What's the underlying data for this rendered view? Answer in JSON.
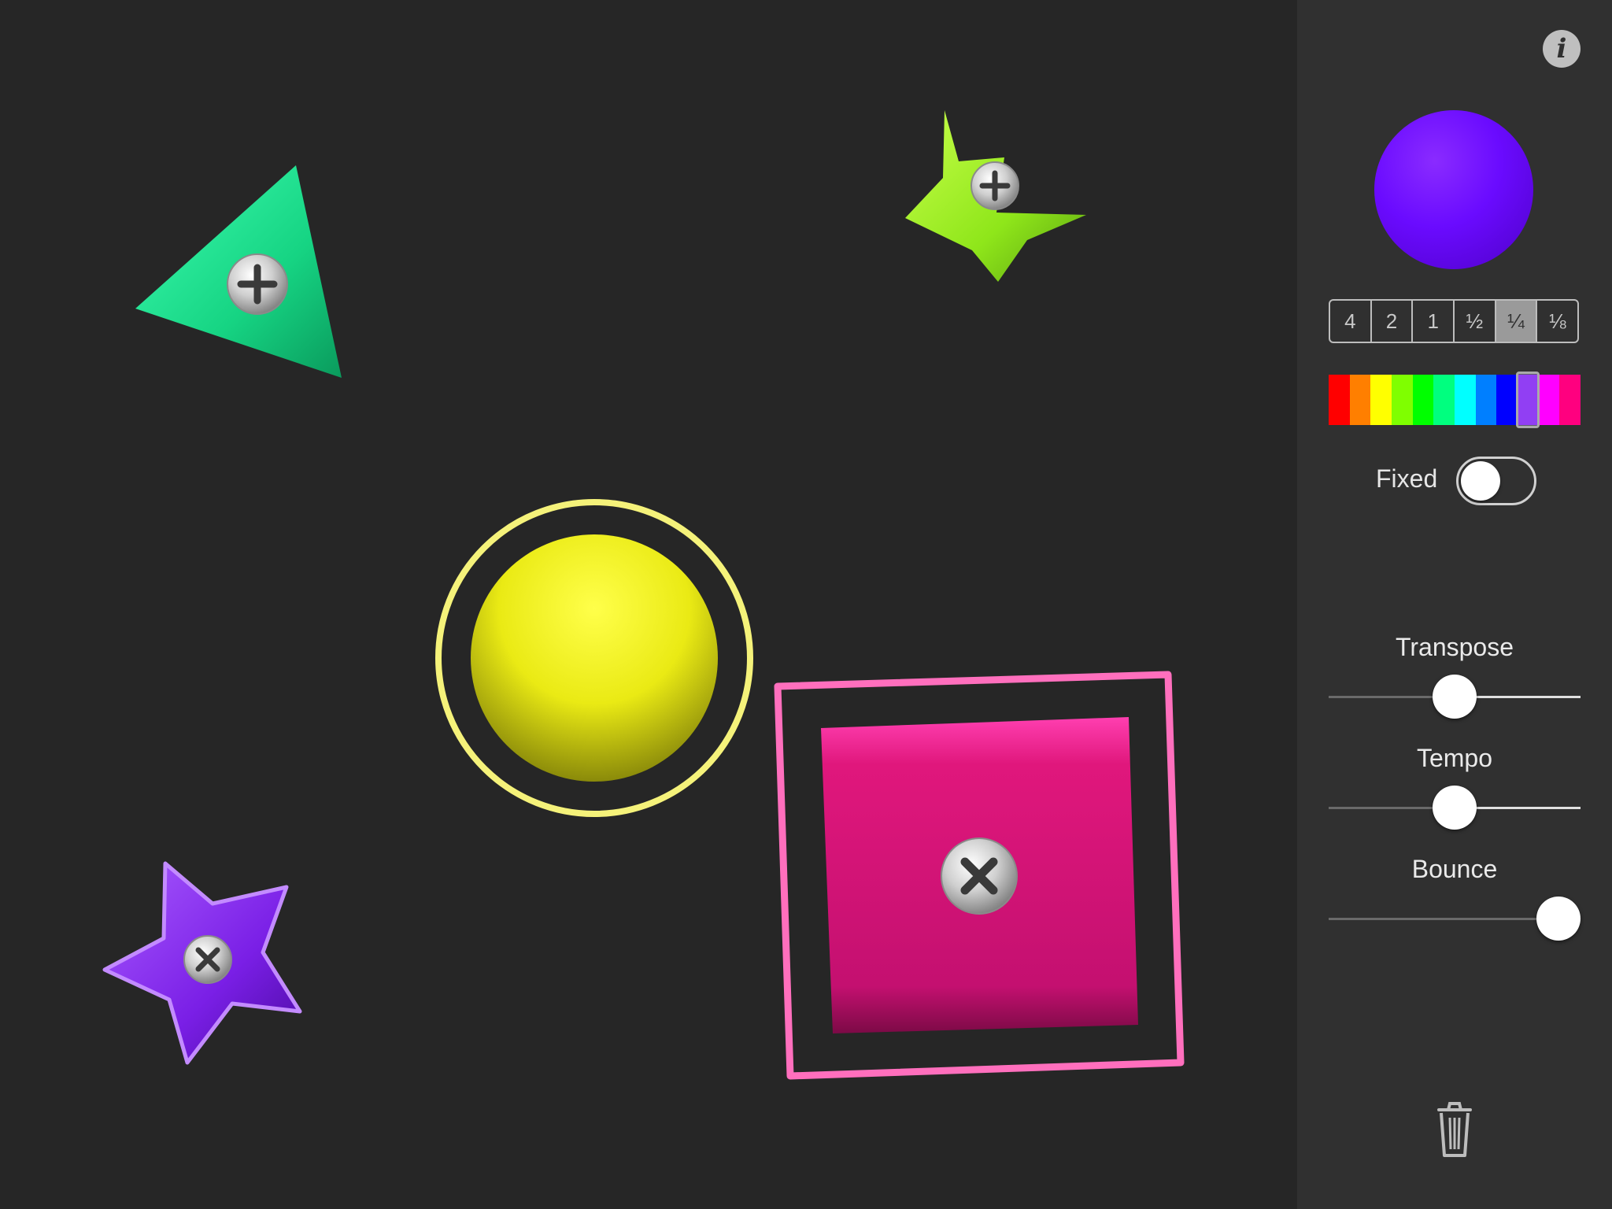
{
  "app": {
    "info_button": "i"
  },
  "toolbar": {
    "duration_options": [
      "4",
      "2",
      "1",
      "½",
      "¼",
      "⅛"
    ],
    "selected_duration": "¼",
    "palette": [
      "#ff0000",
      "#ff7f00",
      "#ffff00",
      "#7fff00",
      "#00ff00",
      "#00ff7f",
      "#00ffff",
      "#007fff",
      "#0000ff",
      "#7f00ff",
      "#ff00ff",
      "#ff007f"
    ],
    "selected_color": "#6a0bff",
    "fixed_label": "Fixed",
    "fixed_on": false
  },
  "sliders": [
    {
      "label": "Transpose",
      "value": 0.5
    },
    {
      "label": "Tempo",
      "value": 0.5
    },
    {
      "label": "Bounce",
      "value": 1.0
    }
  ],
  "shapes": [
    {
      "type": "triangle",
      "color": "#1fe08a",
      "screw": "plus"
    },
    {
      "type": "star",
      "color": "#8fe61a",
      "screw": "plus"
    },
    {
      "type": "circle",
      "color": "#f2f21a",
      "selected": true
    },
    {
      "type": "square",
      "color": "#e0177c",
      "screw": "cross",
      "selected": true
    },
    {
      "type": "star",
      "color": "#7a1fe6",
      "screw": "cross",
      "selected": true
    }
  ]
}
